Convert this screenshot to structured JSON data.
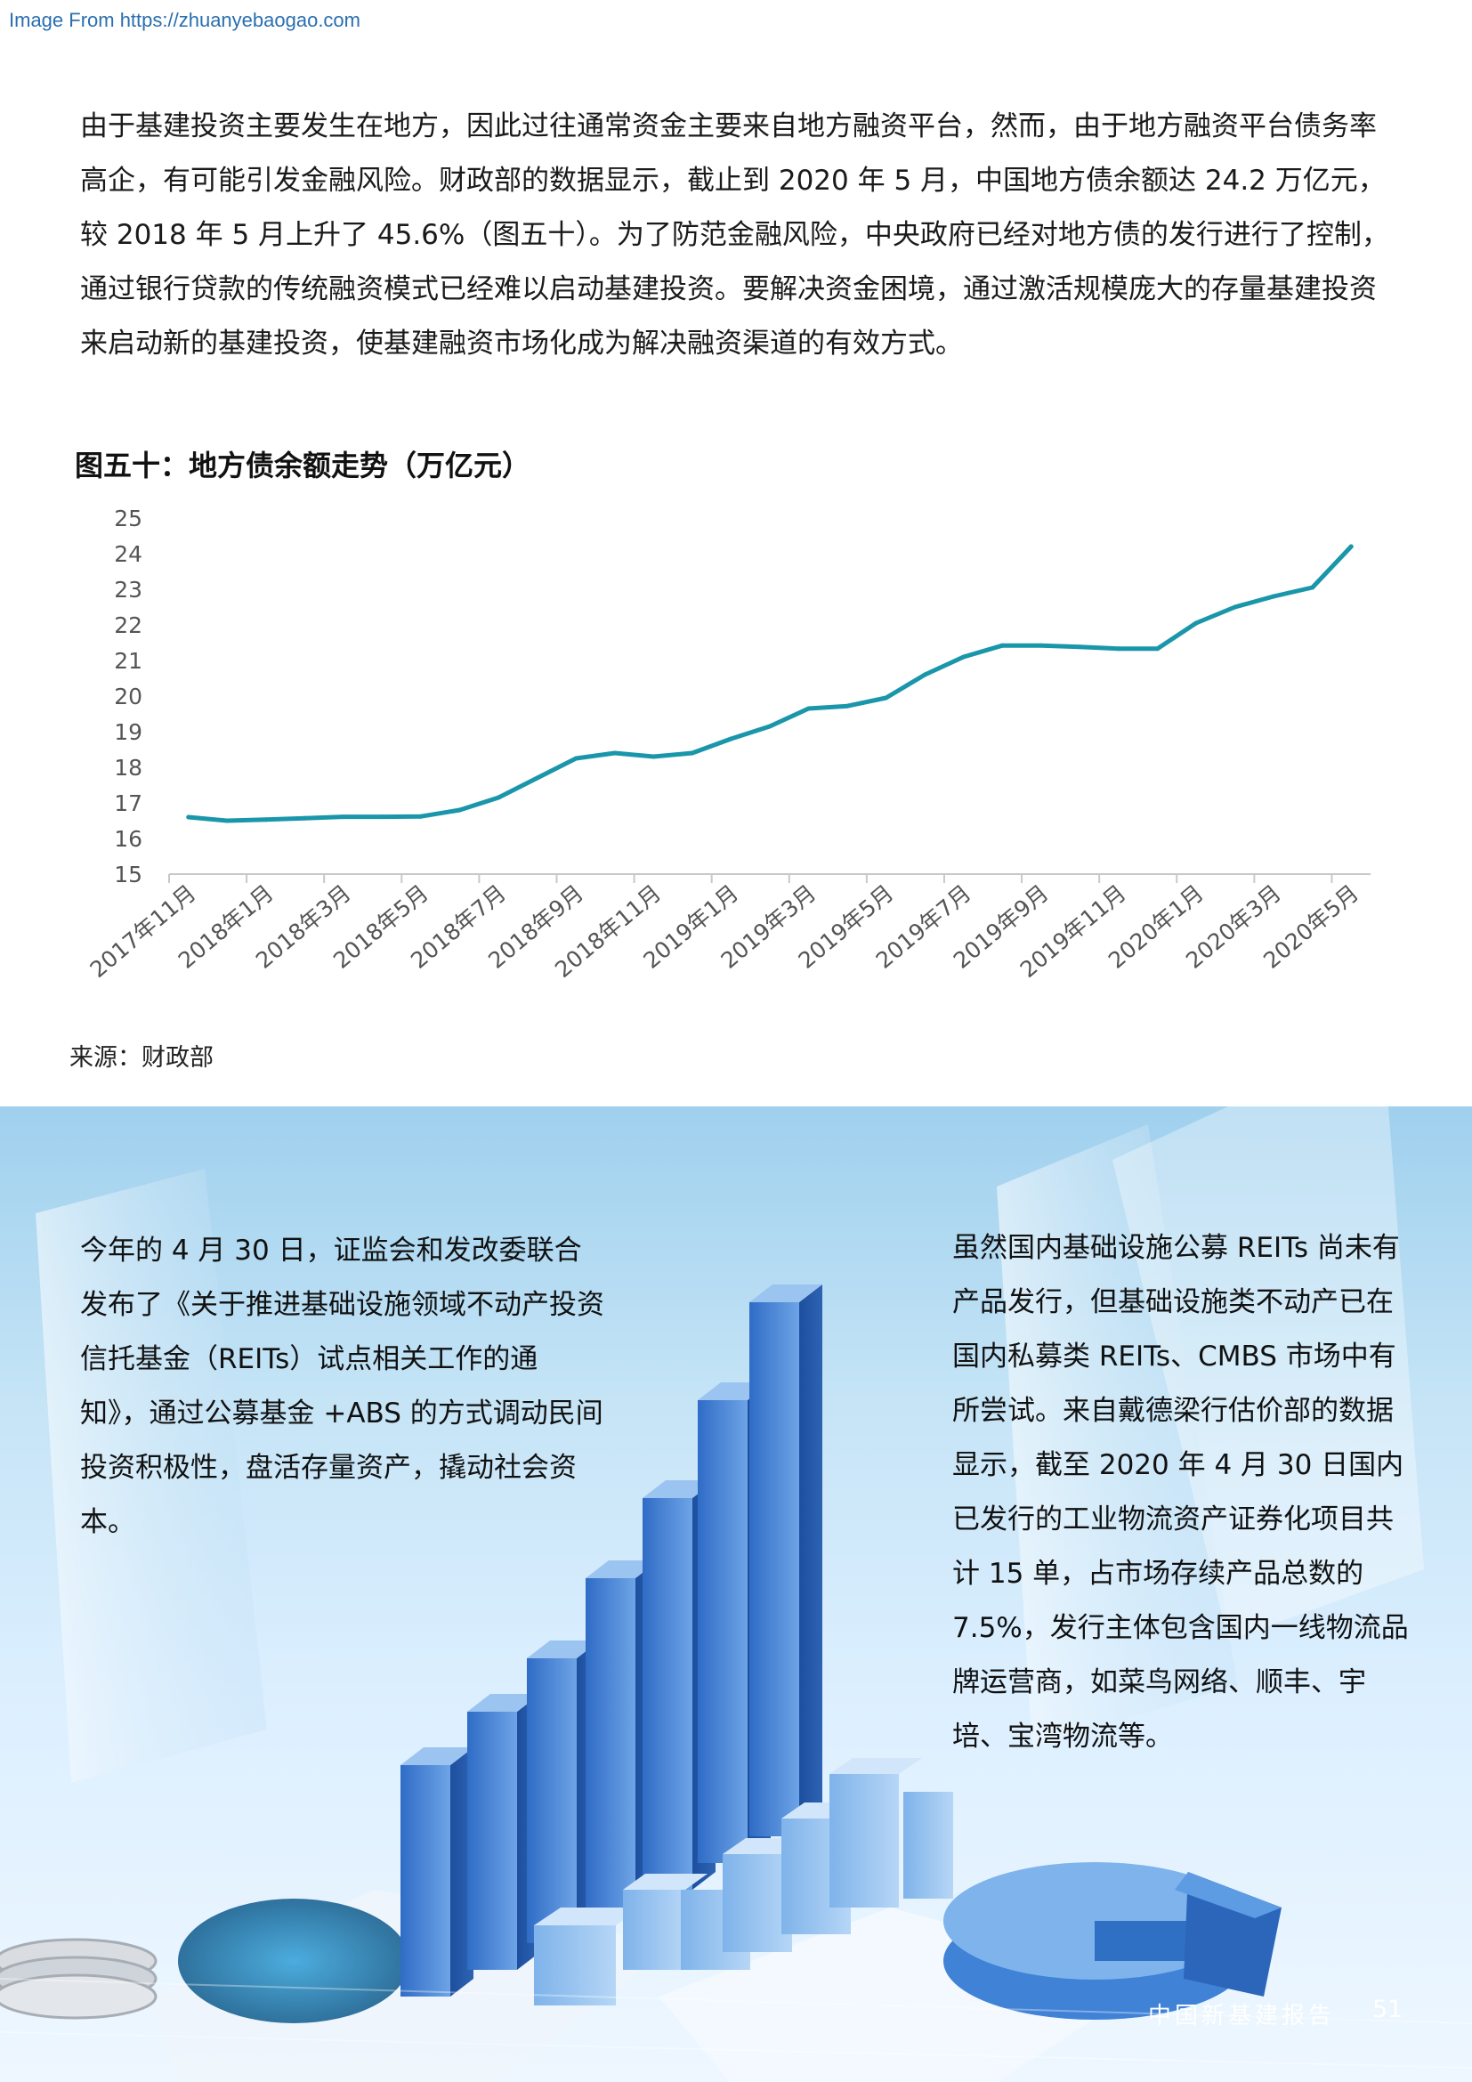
{
  "watermark": "Image From https://zhuanyebaogao.com",
  "intro_paragraph": "由于基建投资主要发生在地方，因此过往通常资金主要来自地方融资平台，然而，由于地方融资平台债务率高企，有可能引发金融风险。财政部的数据显示，截止到 2020 年 5 月，中国地方债余额达 24.2 万亿元，较 2018 年 5 月上升了 45.6%（图五十）。为了防范金融风险，中央政府已经对地方债的发行进行了控制，通过银行贷款的传统融资模式已经难以启动基建投资。要解决资金困境，通过激活规模庞大的存量基建投资来启动新的基建投资，使基建融资市场化成为解决融资渠道的有效方式。",
  "figure_title": "图五十：地方债余额走势（万亿元）",
  "source": "来源：财政部",
  "left_column_text": "今年的 4 月 30 日，证监会和发改委联合发布了《关于推进基础设施领域不动产投资信托基金（REITs）试点相关工作的通知》，通过公募基金 +ABS 的方式调动民间投资积极性，盘活存量资产，撬动社会资本。",
  "right_column_text": "虽然国内基础设施公募 REITs 尚未有产品发行，但基础设施类不动产已在国内私募类 REITs、CMBS 市场中有所尝试。来自戴德梁行估价部的数据显示，截至 2020 年 4 月 30 日国内已发行的工业物流资产证券化项目共计 15 单，占市场存续产品总数的 7.5%，发行主体包含国内一线物流品牌运营商，如菜鸟网络、顺丰、宇培、宝湾物流等。",
  "footer": {
    "report_title": "中国新基建报告",
    "page_number": "51"
  },
  "chart_data": {
    "type": "line",
    "title": "图五十：地方债余额走势（万亿元）",
    "x": [
      "2017年11月",
      "2017年12月",
      "2018年1月",
      "2018年2月",
      "2018年3月",
      "2018年4月",
      "2018年5月",
      "2018年6月",
      "2018年7月",
      "2018年8月",
      "2018年9月",
      "2018年10月",
      "2018年11月",
      "2018年12月",
      "2019年1月",
      "2019年2月",
      "2019年3月",
      "2019年4月",
      "2019年5月",
      "2019年6月",
      "2019年7月",
      "2019年8月",
      "2019年9月",
      "2019年10月",
      "2019年11月",
      "2019年12月",
      "2020年1月",
      "2020年2月",
      "2020年3月",
      "2020年4月",
      "2020年5月"
    ],
    "tick_labels": [
      "2017年11月",
      "2018年1月",
      "2018年3月",
      "2018年5月",
      "2018年7月",
      "2018年9月",
      "2018年11月",
      "2019年1月",
      "2019年3月",
      "2019年5月",
      "2019年7月",
      "2019年9月",
      "2019年11月",
      "2020年1月",
      "2020年3月",
      "2020年5月"
    ],
    "series": [
      {
        "values": [
          16.6,
          16.5,
          16.53,
          16.57,
          16.61,
          16.61,
          16.62,
          16.8,
          17.15,
          17.7,
          18.25,
          18.4,
          18.3,
          18.4,
          18.8,
          19.15,
          19.65,
          19.72,
          19.95,
          20.6,
          21.1,
          21.42,
          21.42,
          21.38,
          21.33,
          21.33,
          22.05,
          22.5,
          22.8,
          23.05,
          24.2
        ]
      }
    ],
    "ylim": [
      15,
      25
    ],
    "yticks": [
      15,
      16,
      17,
      18,
      19,
      20,
      21,
      22,
      23,
      24,
      25
    ],
    "grid": false,
    "line_color": "#1a96aa"
  }
}
